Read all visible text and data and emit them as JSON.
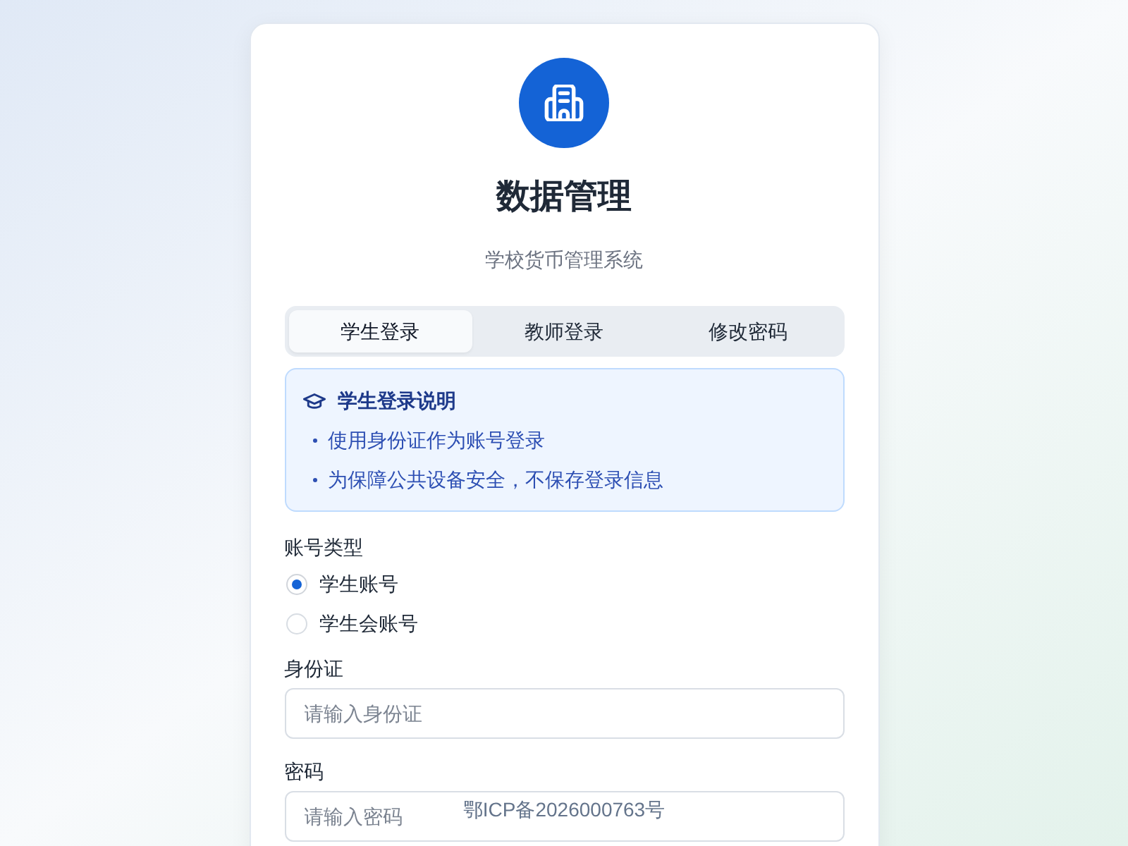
{
  "brand": {
    "title": "数据管理",
    "subtitle": "学校货币管理系统"
  },
  "tabs": [
    {
      "label": "学生登录",
      "selected": true
    },
    {
      "label": "教师登录",
      "selected": false
    },
    {
      "label": "修改密码",
      "selected": false
    }
  ],
  "notice": {
    "title": "学生登录说明",
    "items": [
      "使用身份证作为账号登录",
      "为保障公共设备安全，不保存登录信息"
    ]
  },
  "account_type": {
    "label": "账号类型",
    "options": [
      {
        "label": "学生账号",
        "selected": true
      },
      {
        "label": "学生会账号",
        "selected": false
      }
    ]
  },
  "fields": [
    {
      "label": "身份证",
      "placeholder": "请输入身份证"
    },
    {
      "label": "密码",
      "placeholder": "请输入密码"
    }
  ],
  "footer": {
    "text": "鄂ICP备2026000763号"
  }
}
